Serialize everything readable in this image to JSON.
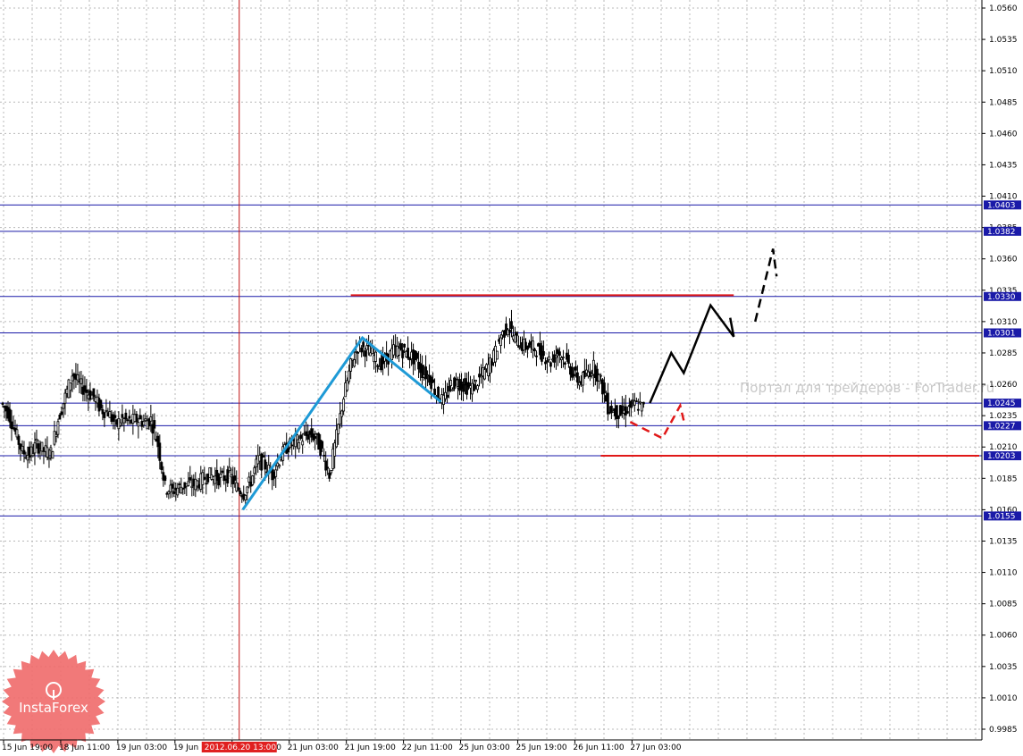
{
  "watermark": "Портал для трейдеров - ForTrader.ru",
  "logo": {
    "text": "InstaForex",
    "color": "#f06a6a"
  },
  "colors": {
    "candle": "#000000",
    "hline": "#1a1aa8",
    "label_bg": "#1a1aa8",
    "grid": "#b8b8b8",
    "cursor": "#c01010",
    "cursor_label_bg": "#e02020",
    "zigzag": "#1e9ad6",
    "forecast": "#000000",
    "alt_forecast": "#e01818",
    "resistance": "#e01818"
  },
  "chart_data": {
    "type": "candlestick",
    "title": "",
    "ylim": [
      0.9985,
      1.056
    ],
    "xlim": [
      0,
      1100
    ],
    "y_ticks": [
      "1.0560",
      "1.0535",
      "1.0510",
      "1.0485",
      "1.0460",
      "1.0435",
      "1.0410",
      "1.0385",
      "1.0360",
      "1.0335",
      "1.0310",
      "1.0285",
      "1.0260",
      "1.0235",
      "1.0210",
      "1.0185",
      "1.0160",
      "1.0135",
      "1.0110",
      "1.0085",
      "1.0060",
      "1.0035",
      "1.0010",
      "0.9985"
    ],
    "x_ticks": [
      {
        "label": "15 Jun 19:00",
        "pos": 4
      },
      {
        "label": "18 Jun 11:00",
        "pos": 68
      },
      {
        "label": "19 Jun 03:00",
        "pos": 132
      },
      {
        "label": "19 Jun 19:00",
        "pos": 196
      },
      {
        "label": "20 Jun 11:00",
        "pos": 260
      },
      {
        "label": "21 Jun 03:00",
        "pos": 324
      },
      {
        "label": "21 Jun 19:00",
        "pos": 388
      },
      {
        "label": "22 Jun 11:00",
        "pos": 452
      },
      {
        "label": "25 Jun 03:00",
        "pos": 516
      },
      {
        "label": "25 Jun 19:00",
        "pos": 580
      },
      {
        "label": "26 Jun 11:00",
        "pos": 644
      },
      {
        "label": "27 Jun 03:00",
        "pos": 708
      }
    ],
    "cursor": {
      "label": "2012.06.20 13:00",
      "pos": 268
    },
    "price_levels": [
      "1.0403",
      "1.0382",
      "1.0330",
      "1.0301",
      "1.0245",
      "1.0227",
      "1.0203",
      "1.0155"
    ],
    "price_level_values": [
      1.0403,
      1.0382,
      1.033,
      1.0301,
      1.0245,
      1.0227,
      1.0203,
      1.0155
    ],
    "resistance_segments": [
      {
        "x1": 393,
        "x2": 822,
        "y": 1.0331
      },
      {
        "x1": 673,
        "x2": 1097,
        "y": 1.0203
      }
    ],
    "zigzag": [
      [
        272,
        1.016
      ],
      [
        406,
        1.0297
      ],
      [
        494,
        1.0246
      ]
    ],
    "forecast_solid": [
      [
        728,
        1.0245
      ],
      [
        752,
        1.0285
      ],
      [
        766,
        1.0269
      ],
      [
        796,
        1.0323
      ],
      [
        822,
        1.0298
      ],
      [
        818,
        1.0313
      ]
    ],
    "forecast_dashed": [
      [
        846,
        1.031
      ],
      [
        866,
        1.0368
      ],
      [
        870,
        1.0346
      ]
    ],
    "alt_forecast_dashed": [
      [
        706,
        1.023
      ],
      [
        742,
        1.0217
      ],
      [
        762,
        1.0243
      ],
      [
        766,
        1.0231
      ]
    ],
    "price_path": [
      [
        2,
        1.0245
      ],
      [
        10,
        1.0238
      ],
      [
        18,
        1.0222
      ],
      [
        26,
        1.0206
      ],
      [
        34,
        1.0204
      ],
      [
        42,
        1.0212
      ],
      [
        50,
        1.0207
      ],
      [
        58,
        1.0205
      ],
      [
        66,
        1.0232
      ],
      [
        74,
        1.025
      ],
      [
        82,
        1.0268
      ],
      [
        90,
        1.026
      ],
      [
        98,
        1.0254
      ],
      [
        106,
        1.025
      ],
      [
        114,
        1.024
      ],
      [
        122,
        1.0238
      ],
      [
        130,
        1.0228
      ],
      [
        138,
        1.0232
      ],
      [
        146,
        1.023
      ],
      [
        154,
        1.0232
      ],
      [
        162,
        1.023
      ],
      [
        170,
        1.0232
      ],
      [
        178,
        1.0212
      ],
      [
        186,
        1.0178
      ],
      [
        194,
        1.0175
      ],
      [
        202,
        1.0178
      ],
      [
        210,
        1.018
      ],
      [
        218,
        1.018
      ],
      [
        226,
        1.0183
      ],
      [
        234,
        1.0188
      ],
      [
        242,
        1.0186
      ],
      [
        250,
        1.0185
      ],
      [
        258,
        1.0188
      ],
      [
        266,
        1.0178
      ],
      [
        274,
        1.0173
      ],
      [
        282,
        1.0183
      ],
      [
        290,
        1.02
      ],
      [
        298,
        1.0195
      ],
      [
        306,
        1.0188
      ],
      [
        314,
        1.02
      ],
      [
        322,
        1.021
      ],
      [
        330,
        1.0213
      ],
      [
        338,
        1.0216
      ],
      [
        346,
        1.022
      ],
      [
        354,
        1.0218
      ],
      [
        362,
        1.0206
      ],
      [
        370,
        1.0188
      ],
      [
        378,
        1.0218
      ],
      [
        386,
        1.025
      ],
      [
        394,
        1.0275
      ],
      [
        402,
        1.029
      ],
      [
        410,
        1.0288
      ],
      [
        418,
        1.0284
      ],
      [
        426,
        1.0276
      ],
      [
        434,
        1.028
      ],
      [
        442,
        1.0287
      ],
      [
        450,
        1.0288
      ],
      [
        458,
        1.0284
      ],
      [
        466,
        1.028
      ],
      [
        474,
        1.027
      ],
      [
        482,
        1.0266
      ],
      [
        490,
        1.0252
      ],
      [
        498,
        1.0246
      ],
      [
        506,
        1.026
      ],
      [
        514,
        1.0262
      ],
      [
        522,
        1.0258
      ],
      [
        530,
        1.0257
      ],
      [
        538,
        1.0264
      ],
      [
        546,
        1.0272
      ],
      [
        554,
        1.0282
      ],
      [
        562,
        1.0298
      ],
      [
        570,
        1.0307
      ],
      [
        578,
        1.0296
      ],
      [
        586,
        1.0291
      ],
      [
        594,
        1.029
      ],
      [
        602,
        1.0288
      ],
      [
        610,
        1.0283
      ],
      [
        618,
        1.0278
      ],
      [
        626,
        1.0286
      ],
      [
        634,
        1.028
      ],
      [
        642,
        1.027
      ],
      [
        650,
        1.0262
      ],
      [
        658,
        1.0268
      ],
      [
        666,
        1.0274
      ],
      [
        674,
        1.0262
      ],
      [
        682,
        1.0242
      ],
      [
        690,
        1.0238
      ],
      [
        698,
        1.0237
      ],
      [
        706,
        1.0242
      ],
      [
        714,
        1.0244
      ],
      [
        722,
        1.0241
      ]
    ]
  }
}
